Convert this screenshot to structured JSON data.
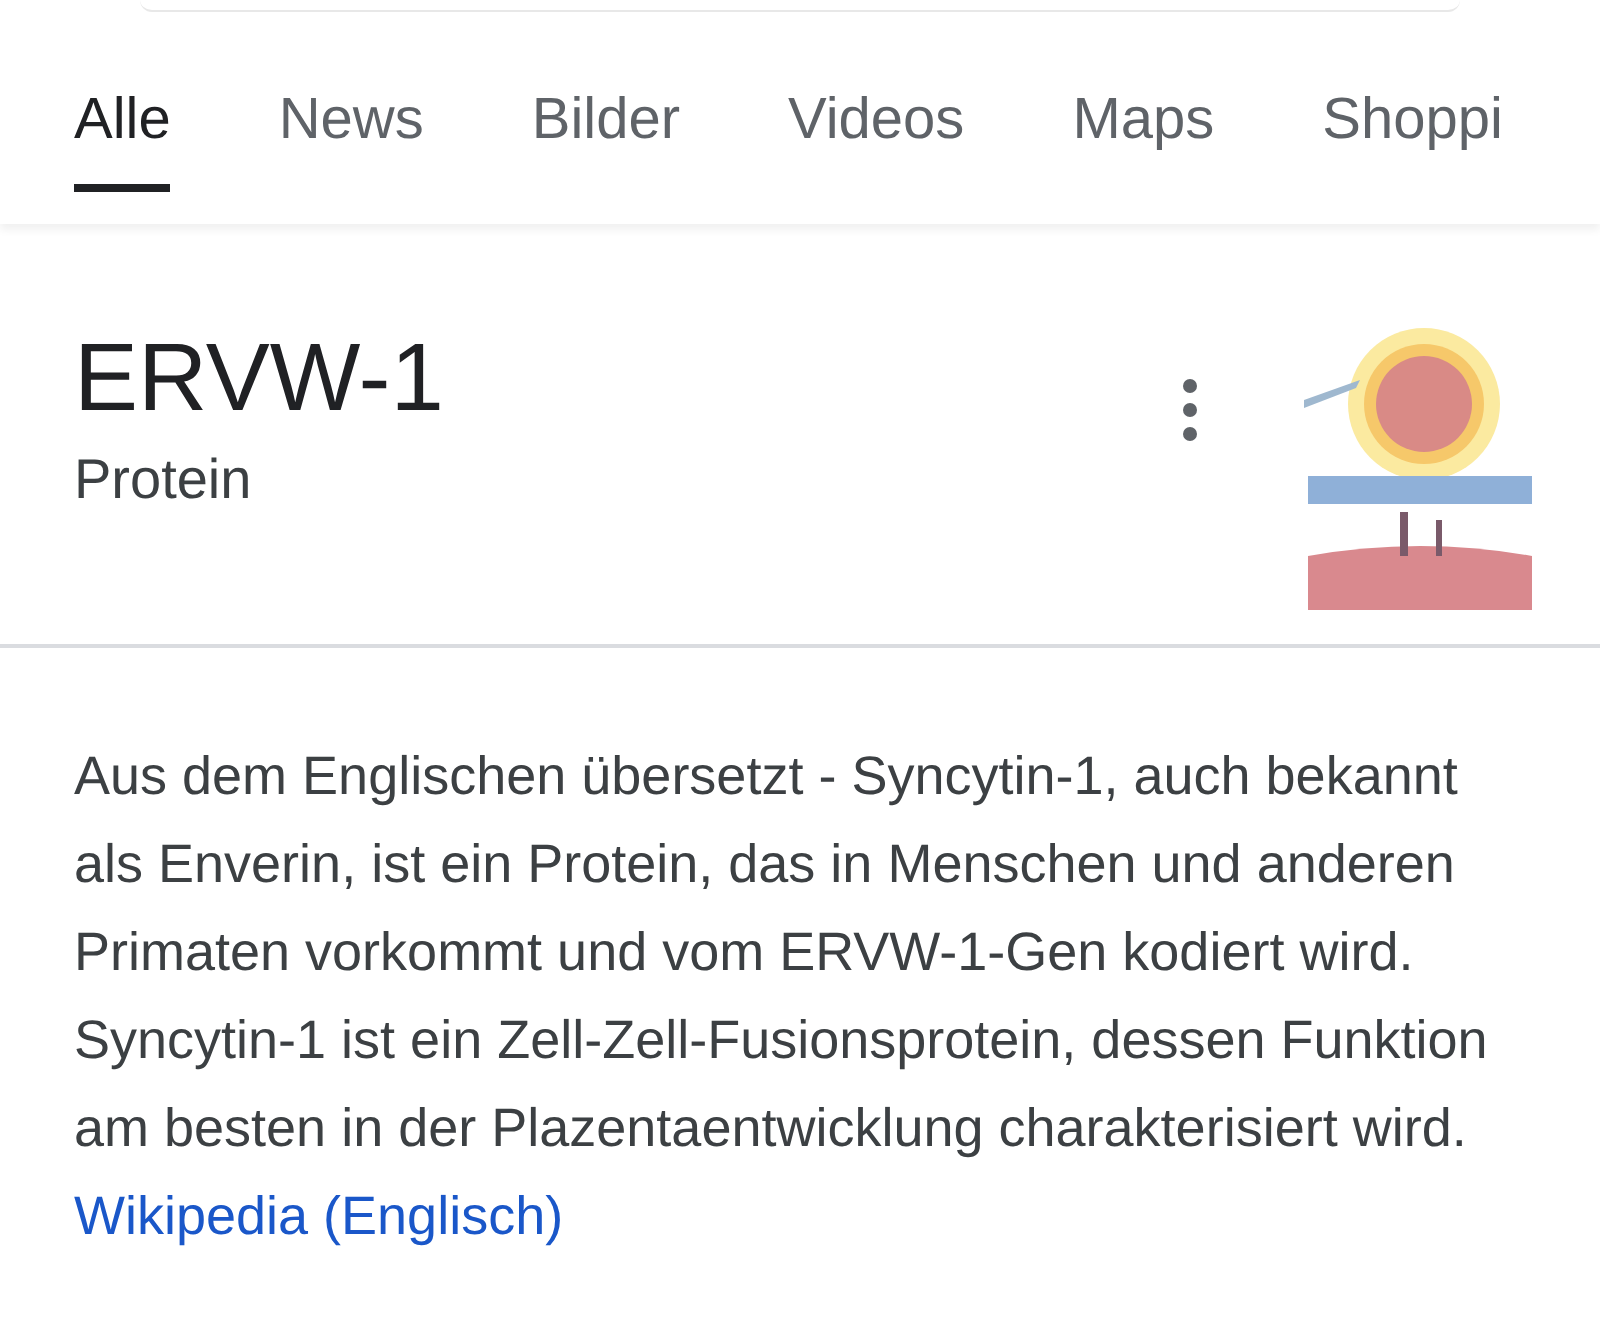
{
  "tabs": [
    {
      "label": "Alle",
      "selected": true
    },
    {
      "label": "News",
      "selected": false
    },
    {
      "label": "Bilder",
      "selected": false
    },
    {
      "label": "Videos",
      "selected": false
    },
    {
      "label": "Maps",
      "selected": false
    },
    {
      "label": "Shoppi",
      "selected": false
    }
  ],
  "entity": {
    "title": "ERVW-1",
    "subtitle": "Protein"
  },
  "description": {
    "text": "Aus dem Englischen übersetzt - Syncytin-1, auch bekannt als Enverin, ist ein Protein, das in Menschen und anderen Primaten vorkommt und vom ERVW-1-Gen kodiert wird. Syncytin-1 ist ein Zell-Zell-Fusionsprotein, dessen Funktion am besten in der Plazentaentwicklung charakterisiert wird.",
    "link": "Wikipedia (Englisch)"
  }
}
